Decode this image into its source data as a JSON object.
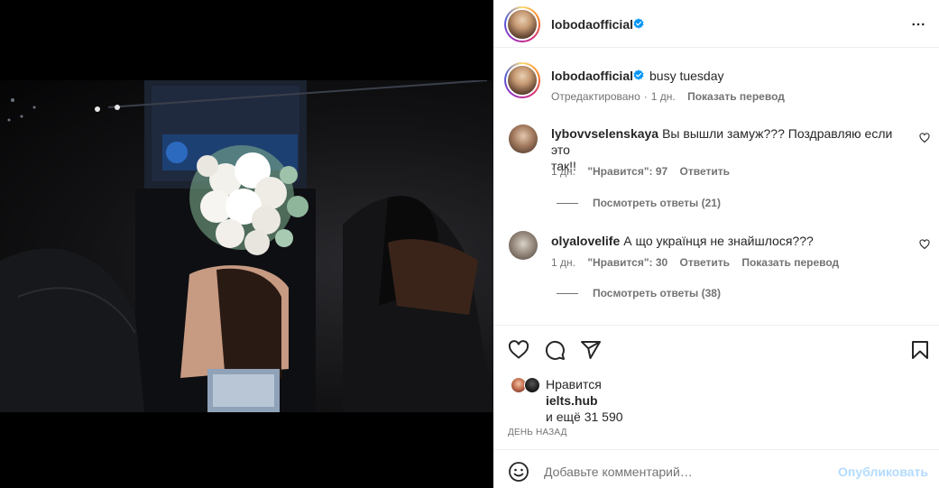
{
  "post": {
    "author": "lobodaofficial",
    "caption": "busy tuesday",
    "meta": {
      "edited": "Отредактировано",
      "time": "1 дн.",
      "translate": "Показать перевод"
    }
  },
  "comments": [
    {
      "username": "lybovvselenskaya",
      "text": "Вы вышли замуж??? Поздравляю если это",
      "text_line2": "так!!",
      "time": "1 дн.",
      "likes": "\"Нравится\": 97",
      "reply": "Ответить",
      "view_replies": "Посмотреть ответы (21)"
    },
    {
      "username": "olyalovelife",
      "text": "А що українця не знайшлося???",
      "time": "1 дн.",
      "likes": "\"Нравится\": 30",
      "reply": "Ответить",
      "translate": "Показать перевод",
      "view_replies": "Посмотреть ответы (38)"
    }
  ],
  "likes": {
    "label": "Нравится",
    "user": "ielts.hub",
    "others": "и ещё 31 590"
  },
  "posted": "ДЕНЬ НАЗАД",
  "comment_box": {
    "placeholder": "Добавьте комментарий…",
    "publish": "Опубликовать"
  },
  "icons": {
    "more": "more-horizontal-icon",
    "like": "heart-icon",
    "comment": "comment-icon",
    "share": "share-icon",
    "save": "bookmark-icon",
    "emoji": "emoji-icon",
    "verified": "verified-badge-icon"
  },
  "colors": {
    "verified": "#0095f6",
    "publish_disabled": "#b3dbff",
    "secondary_text": "#737373"
  }
}
